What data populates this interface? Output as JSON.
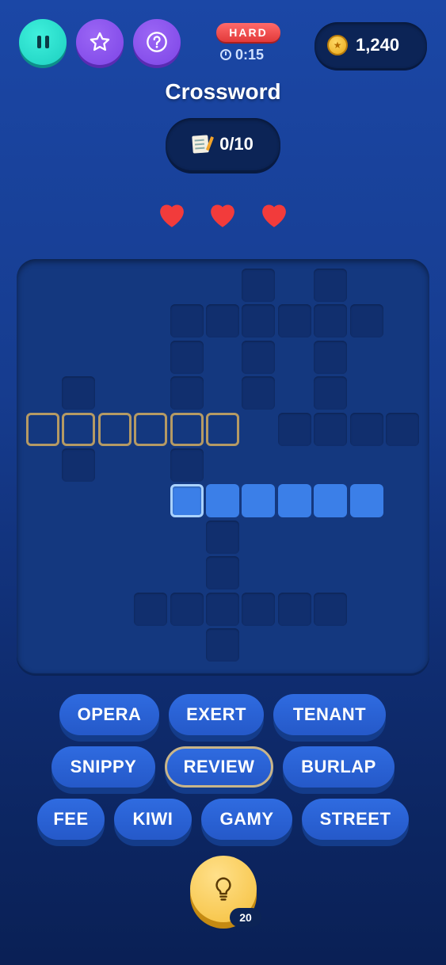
{
  "header": {
    "pause_icon": "pause-icon",
    "star_icon": "star-icon",
    "help_icon": "question-mark-icon",
    "difficulty": "HARD",
    "timer": "0:15",
    "coins": "1,240"
  },
  "title": "Crossword",
  "progress": "0/10",
  "lives": {
    "count": 3,
    "icon": "heart-icon",
    "color": "#f23b3b"
  },
  "board": {
    "colors": {
      "empty": "#112f6e",
      "active": "#3b7fe8",
      "selected_outline": "#b59a64"
    }
  },
  "word_bank": {
    "words": [
      "OPERA",
      "EXERT",
      "TENANT",
      "SNIPPY",
      "REVIEW",
      "BURLAP",
      "FEE",
      "KIWI",
      "GAMY",
      "STREET"
    ],
    "selected": "REVIEW"
  },
  "hint": {
    "icon": "lightbulb-icon",
    "count": "20"
  }
}
